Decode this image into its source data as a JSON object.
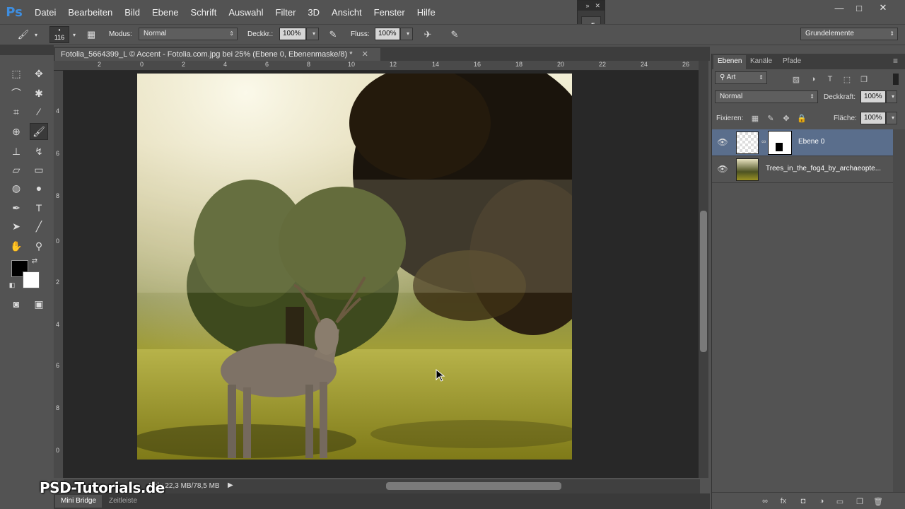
{
  "app": {
    "logo": "Ps"
  },
  "menu": [
    "Datei",
    "Bearbeiten",
    "Bild",
    "Ebene",
    "Schrift",
    "Auswahl",
    "Filter",
    "3D",
    "Ansicht",
    "Fenster",
    "Hilfe"
  ],
  "window_controls": [
    "—",
    "□",
    "✕"
  ],
  "float_panel": {
    "collapse": "»",
    "close": "✕",
    "icon": "history-icon"
  },
  "options_bar": {
    "brush_size": "116",
    "mode_label": "Modus:",
    "mode_value": "Normal",
    "opacity_label": "Deckkr.:",
    "opacity_value": "100%",
    "flow_label": "Fluss:",
    "flow_value": "100%",
    "workspace": "Grundelemente"
  },
  "document": {
    "tab_title": "Fotolia_5664399_L © Accent - Fotolia.com.jpg bei 25% (Ebene 0, Ebenenmaske/8) *",
    "tab_close": "✕",
    "ruler_top": [
      "2",
      "0",
      "2",
      "4",
      "6",
      "8",
      "10",
      "12",
      "14",
      "16",
      "18",
      "20",
      "22",
      "24",
      "26"
    ],
    "ruler_left": [
      "4",
      "6",
      "8",
      "0",
      "2",
      "4",
      "6",
      "8",
      "0"
    ],
    "status": "Dok: 22,3 MB/78,5 MB"
  },
  "watermark": "PSD-Tutorials.de",
  "bottom_tabs": [
    "Mini Bridge",
    "Zeitleiste"
  ],
  "layers_panel": {
    "tabs": [
      "Ebenen",
      "Kanäle",
      "Pfade"
    ],
    "filter_kind": "Art",
    "blend_mode": "Normal",
    "opacity_label": "Deckkraft:",
    "opacity_value": "100%",
    "lock_label": "Fixieren:",
    "fill_label": "Fläche:",
    "fill_value": "100%",
    "layers": [
      {
        "name": "Ebene 0",
        "selected": true
      },
      {
        "name": "Trees_in_the_fog4_by_archaeopte...",
        "selected": false
      }
    ]
  },
  "colors": {
    "accent": "#5a6e8c",
    "logo": "#3e8ee0",
    "background": "#535353"
  }
}
